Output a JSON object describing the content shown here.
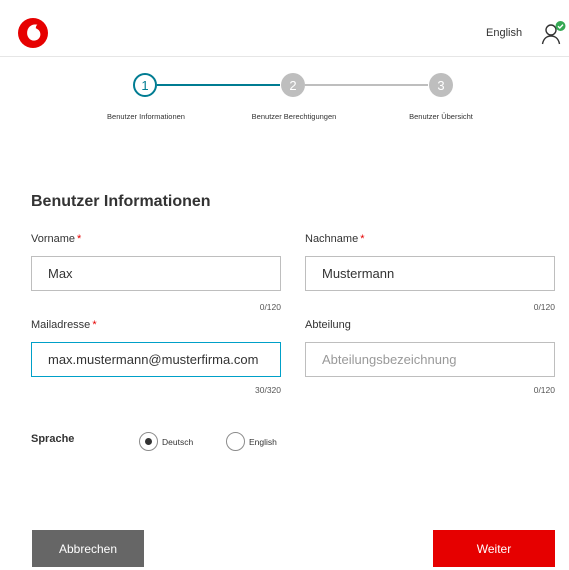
{
  "header": {
    "language_link": "English",
    "brand_color": "#e60000",
    "user_status_color": "#34a853",
    "icons": {
      "logo": "vodafone-speechmark-icon",
      "user": "user-verified-icon"
    }
  },
  "stepper": {
    "active_color": "#007c92",
    "inactive_color": "#bebebe",
    "steps": [
      {
        "number": "1",
        "label": "Benutzer Informationen",
        "state": "active"
      },
      {
        "number": "2",
        "label": "Benutzer Berechtigungen",
        "state": "inactive"
      },
      {
        "number": "3",
        "label": "Benutzer Übersicht",
        "state": "inactive"
      }
    ]
  },
  "form": {
    "title": "Benutzer Informationen",
    "required_marker": "*",
    "fields": {
      "vorname": {
        "label": "Vorname",
        "required": true,
        "value": "Max",
        "placeholder": "",
        "counter": "0/120"
      },
      "nachname": {
        "label": "Nachname",
        "required": true,
        "value": "Mustermann",
        "placeholder": "",
        "counter": "0/120"
      },
      "mail": {
        "label": "Mailadresse",
        "required": true,
        "value": "max.mustermann@musterfirma.com",
        "placeholder": "",
        "counter": "30/320",
        "focused": true
      },
      "abteilung": {
        "label": "Abteilung",
        "required": false,
        "value": "",
        "placeholder": "Abteilungsbezeichnung",
        "counter": "0/120"
      }
    },
    "language": {
      "label": "Sprache",
      "options": [
        {
          "label": "Deutsch",
          "selected": true
        },
        {
          "label": "English",
          "selected": false
        }
      ]
    }
  },
  "actions": {
    "cancel_label": "Abbrechen",
    "next_label": "Weiter",
    "cancel_color": "#666666",
    "next_color": "#e60000"
  }
}
